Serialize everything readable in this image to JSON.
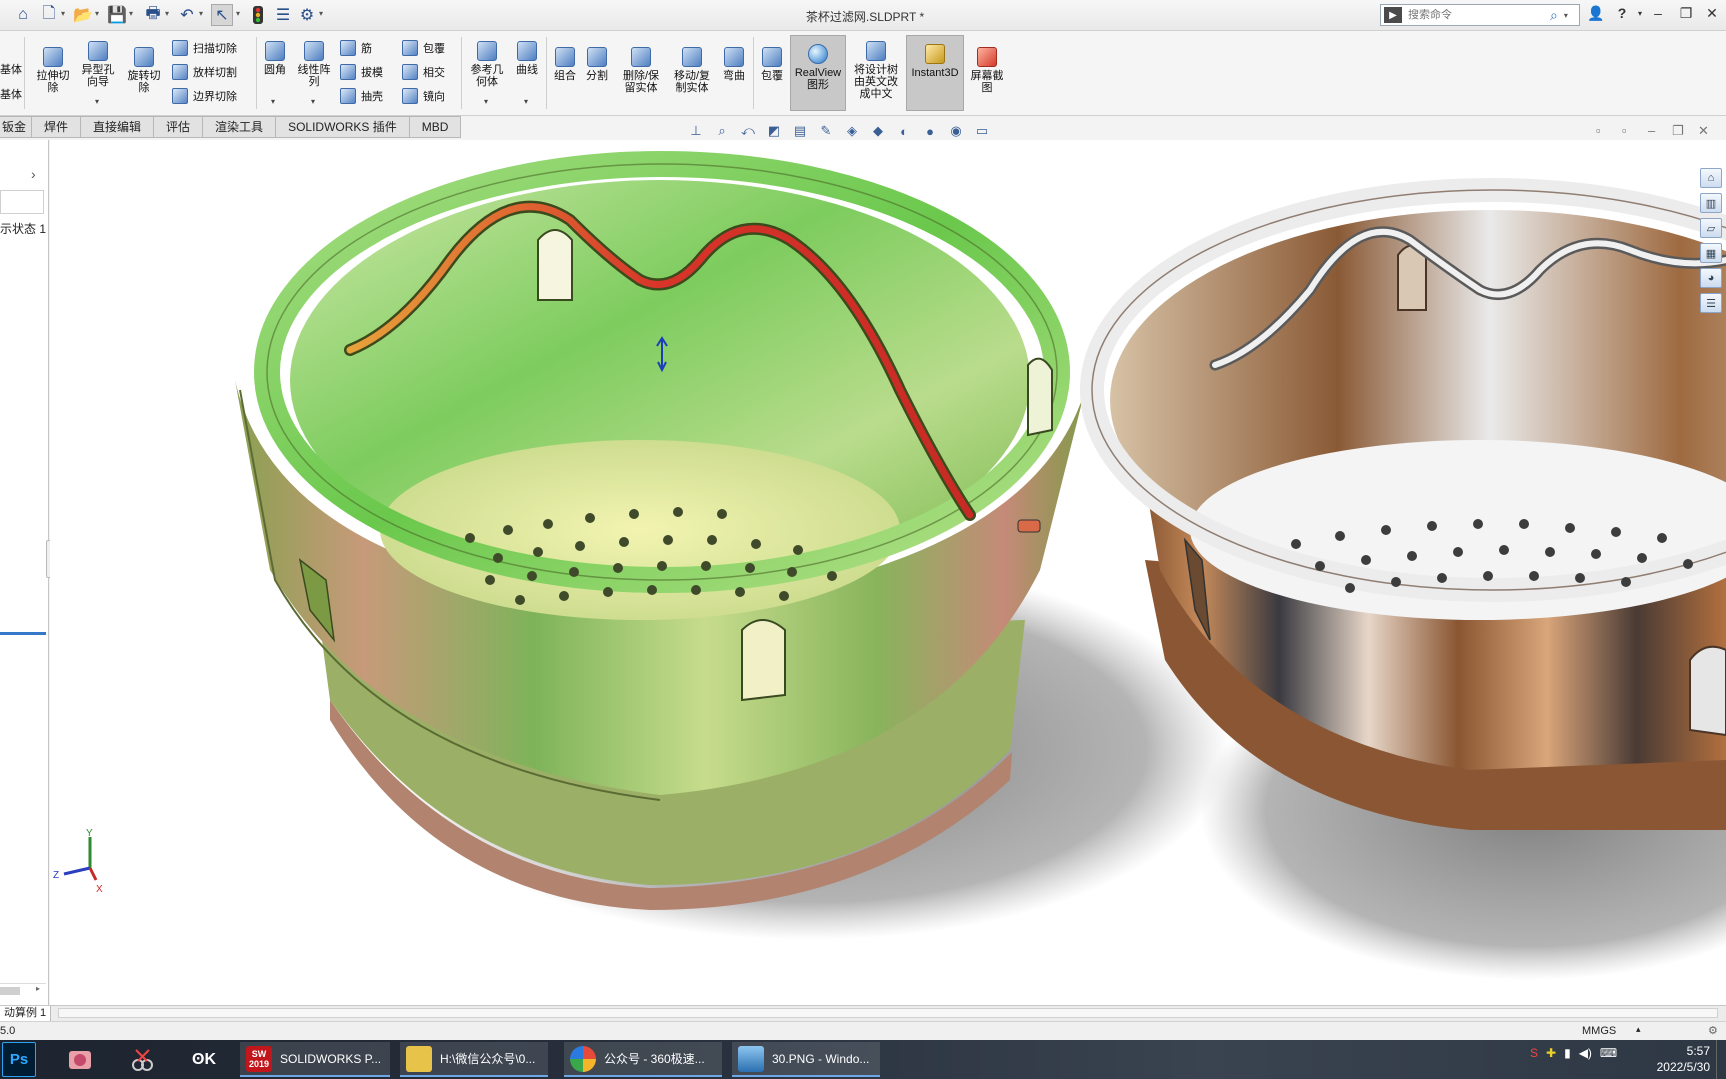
{
  "window": {
    "title": "茶杯过滤网.SLDPRT *",
    "search_placeholder": "搜索命令"
  },
  "ribbon": {
    "left_cut": [
      "基体",
      "基体"
    ],
    "buttons": {
      "extrude_cut": "拉伸切\n除",
      "hole_wizard": "异型孔\n向导",
      "revolve_cut": "旋转切\n除",
      "sweep_cut": "扫描切除",
      "loft_cut": "放样切割",
      "boundary_cut": "边界切除",
      "fillet": "圆角",
      "linear_pattern": "线性阵\n列",
      "rib": "筋",
      "draft": "拔模",
      "shell": "抽壳",
      "wrap": "包覆",
      "intersect": "相交",
      "mirror": "镜向",
      "ref_geometry": "参考几\n何体",
      "curves": "曲线",
      "combine": "组合",
      "split": "分割",
      "delete_keep_body": "删除/保\n留实体",
      "move_copy_body": "移动/复\n制实体",
      "flex": "弯曲",
      "wrap2": "包覆",
      "realview": "RealView\n图形",
      "translate_tree": "将设计树\n由英文改\n成中文",
      "instant3d": "Instant3D",
      "screen_capture": "屏幕截\n图"
    }
  },
  "tabs": [
    "钣金",
    "焊件",
    "直接编辑",
    "评估",
    "渲染工具",
    "SOLIDWORKS 插件",
    "MBD"
  ],
  "left_panel": {
    "display_state": "示状态 1"
  },
  "bottom": {
    "model_tab": "动算例 1",
    "status_left": "5.0",
    "units": "MMGS"
  },
  "taskbar": {
    "tasks": [
      {
        "label": "SOLIDWORKS P...",
        "badge": "2019"
      },
      {
        "label": "H:\\微信公众号\\0..."
      },
      {
        "label": "公众号 - 360极速..."
      },
      {
        "label": "30.PNG - Windo..."
      }
    ],
    "time": "5:57",
    "date": "2022/5/30"
  },
  "colors": {
    "accent": "#3577c8",
    "green_part": "#7cc56a",
    "copper_part": "#b06a3c",
    "chrome": "#e8e8ea"
  },
  "triad": {
    "x": "X",
    "y": "Y",
    "z": "Z"
  }
}
